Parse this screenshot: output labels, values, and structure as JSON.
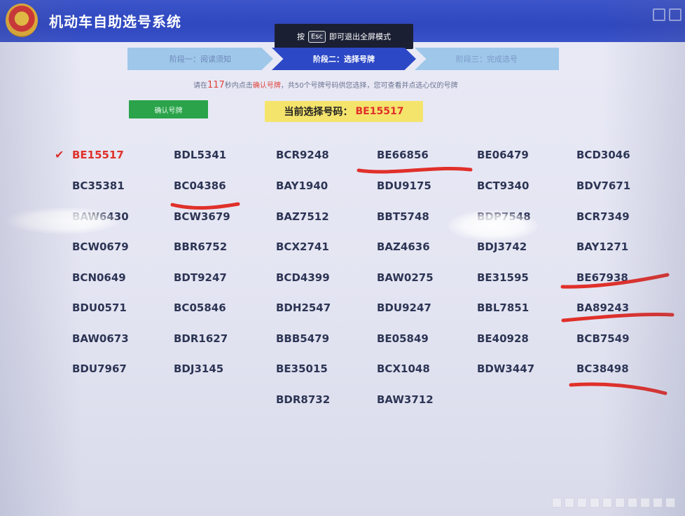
{
  "window": {
    "title": "机动车自助选号系统"
  },
  "esc_hint": {
    "prefix": "按",
    "key": "Esc",
    "suffix": "即可退出全屏模式"
  },
  "steps": [
    {
      "label": "阶段一：阅读须知",
      "state": "done"
    },
    {
      "label": "阶段二：选择号牌",
      "state": "active"
    },
    {
      "label": "阶段三：完成选号",
      "state": "pending"
    }
  ],
  "instruction": {
    "before": "请在",
    "seconds": "117",
    "middle": "秒内点击",
    "action": "确认号牌",
    "after": "，共50个号牌号码供您选择，您可查看并点选心仪的号牌"
  },
  "confirm_button": {
    "label": "确认号牌"
  },
  "current_selection": {
    "label": "当前选择号码：",
    "value": "BE15517"
  },
  "plates": {
    "selected": "BE15517",
    "columns": [
      [
        "BE15517",
        "BC35381",
        "BAW6430",
        "BCW0679",
        "BCN0649",
        "BDU0571",
        "BAW0673",
        "BDU7967"
      ],
      [
        "BDL5341",
        "BC04386",
        "BCW3679",
        "BBR6752",
        "BDT9247",
        "BC05846",
        "BDR1627",
        "BDJ3145"
      ],
      [
        "BCR9248",
        "BAY1940",
        "BAZ7512",
        "BCX2741",
        "BCD4399",
        "BDH2547",
        "BBB5479",
        "BE35015",
        "BDR8732"
      ],
      [
        "BE66856",
        "BDU9175",
        "BBT5748",
        "BAZ4636",
        "BAW0275",
        "BDU9247",
        "BE05849",
        "BCX1048",
        "BAW3712"
      ],
      [
        "BE06479",
        "BCT9340",
        "BDP7548",
        "BDJ3742",
        "BE31595",
        "BBL7851",
        "BE40928",
        "BDW3447"
      ],
      [
        "BCD3046",
        "BDV7671",
        "BCR7349",
        "BAY1271",
        "BE67938",
        "BA89243",
        "BCB7549",
        "BC38498"
      ]
    ]
  },
  "annotations": {
    "underlined": [
      "BE66856",
      "BC04386",
      "BE67938",
      "BA89243",
      "BC38498"
    ],
    "color": "#e0302a"
  },
  "colors": {
    "header": "#2f47bf",
    "active_step": "#2c48c6",
    "confirm_button": "#2aa34a",
    "current_box": "#f5e46c",
    "selected_plate": "#e0302a"
  }
}
